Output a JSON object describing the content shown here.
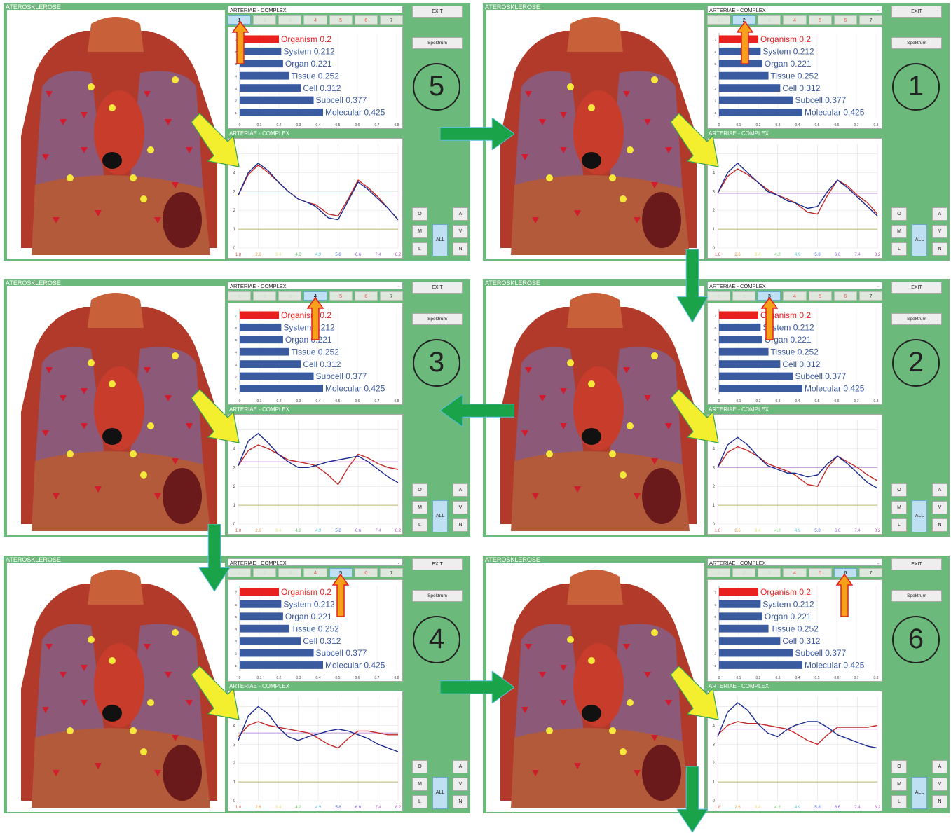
{
  "window_title": "ATEROSKLEROSE",
  "section": "ARTERIAE - COMPLEX",
  "chart_title": "ARTERIAE - COMPLEX",
  "buttons": {
    "exit": "EXIT",
    "spektrum": "Spektrum",
    "o": "O",
    "a": "A",
    "m": "M",
    "v": "V",
    "l": "L",
    "n": "N",
    "all": "ALL"
  },
  "tabs": [
    "1",
    "2",
    "3",
    "4",
    "5",
    "6",
    "7"
  ],
  "colors": {
    "panel": "#6cb97c",
    "bar_blue": "#3a5ba0",
    "bar_red": "#e82020",
    "line_blue": "#1a2a8c",
    "line_red": "#c02828",
    "flow_arrow": "#1aa348",
    "hint_arrow": "#f4ef2e"
  },
  "panels": [
    {
      "step": "5",
      "active_tab": 1
    },
    {
      "step": "1",
      "active_tab": 2
    },
    {
      "step": "3",
      "active_tab": 4
    },
    {
      "step": "2",
      "active_tab": 3
    },
    {
      "step": "4",
      "active_tab": 5
    },
    {
      "step": "6",
      "active_tab": 6
    }
  ],
  "chart_data": [
    {
      "type": "bar",
      "orientation": "horizontal",
      "categories": [
        "Organism 0.2",
        "System 0.212",
        "Organ 0.221",
        "Tissue  0.252",
        "Cell 0.312",
        "Subcell 0.377",
        "Molecular 0.425"
      ],
      "values": [
        0.2,
        0.212,
        0.221,
        0.252,
        0.312,
        0.377,
        0.425
      ],
      "xlim": [
        0,
        0.8
      ],
      "xticks": [
        "0",
        "0.1",
        "0.2",
        "0.3",
        "0.4",
        "0.5",
        "0.6",
        "0.7",
        "0.8"
      ],
      "ylabels": [
        "7",
        "6",
        "5",
        "4",
        "3",
        "2",
        "1"
      ]
    },
    {
      "type": "line",
      "x_ticks": [
        "1.8",
        "2.6",
        "3.4",
        "4.2",
        "4.9",
        "5.8",
        "6.6",
        "7.4",
        "8.2"
      ],
      "x_tick_colors": [
        "#e85a5a",
        "#e8923a",
        "#e6e070",
        "#5cc85c",
        "#5cc8e0",
        "#4a6ae0",
        "#8a5ae0",
        "#b070e0",
        "#b050b0"
      ],
      "yticks": [
        "0",
        "1",
        "2",
        "3",
        "4",
        "5"
      ],
      "ylim": [
        0,
        5.5
      ],
      "x": [
        1.8,
        2.2,
        2.6,
        3.0,
        3.4,
        3.8,
        4.2,
        4.6,
        4.9,
        5.4,
        5.8,
        6.2,
        6.6,
        7.0,
        7.4,
        7.8,
        8.2
      ],
      "panels": [
        {
          "blue": [
            2.8,
            4.0,
            4.5,
            4.1,
            3.5,
            3.0,
            2.6,
            2.4,
            2.2,
            1.6,
            1.5,
            2.5,
            3.5,
            3.1,
            2.6,
            2.1,
            1.5
          ],
          "red": [
            2.8,
            3.9,
            4.4,
            4.0,
            3.5,
            3.0,
            2.6,
            2.4,
            2.3,
            1.8,
            1.7,
            2.6,
            3.6,
            3.2,
            2.7,
            2.1,
            1.5
          ],
          "ref_purple": 2.8,
          "ref_yellow": 1.0
        },
        {
          "blue": [
            2.9,
            4.0,
            4.5,
            4.0,
            3.5,
            3.0,
            2.8,
            2.5,
            2.4,
            2.1,
            2.2,
            3.0,
            3.6,
            3.2,
            2.7,
            2.2,
            1.7
          ],
          "red": [
            2.9,
            3.8,
            4.2,
            3.9,
            3.5,
            3.1,
            2.8,
            2.6,
            2.4,
            1.9,
            1.8,
            2.8,
            3.6,
            3.3,
            2.8,
            2.4,
            1.8
          ],
          "ref_purple": 2.9,
          "ref_yellow": 1.0
        },
        {
          "blue": [
            3.1,
            4.4,
            4.8,
            4.3,
            3.7,
            3.3,
            3.0,
            3.0,
            3.1,
            3.3,
            3.4,
            3.5,
            3.6,
            3.3,
            2.9,
            2.5,
            2.2
          ],
          "red": [
            3.1,
            3.9,
            4.2,
            4.0,
            3.7,
            3.4,
            3.3,
            3.2,
            3.1,
            2.6,
            2.1,
            3.0,
            3.7,
            3.5,
            3.2,
            3.0,
            2.9
          ],
          "ref_purple": 3.3,
          "ref_yellow": 1.0
        },
        {
          "blue": [
            3.0,
            4.2,
            4.6,
            4.2,
            3.6,
            3.1,
            2.9,
            2.7,
            2.7,
            2.5,
            2.6,
            3.2,
            3.6,
            3.2,
            2.7,
            2.2,
            1.9
          ],
          "red": [
            3.0,
            3.8,
            4.1,
            3.9,
            3.6,
            3.2,
            3.0,
            2.8,
            2.6,
            2.1,
            2.0,
            3.0,
            3.6,
            3.3,
            3.0,
            2.6,
            2.3
          ],
          "ref_purple": 3.0,
          "ref_yellow": 1.0
        },
        {
          "blue": [
            3.2,
            4.5,
            5.0,
            4.6,
            3.9,
            3.4,
            3.2,
            3.4,
            3.5,
            3.7,
            3.8,
            3.7,
            3.5,
            3.3,
            3.0,
            2.8,
            2.6
          ],
          "red": [
            3.4,
            4.0,
            4.2,
            4.0,
            3.9,
            3.8,
            3.7,
            3.6,
            3.4,
            3.0,
            2.8,
            3.3,
            3.7,
            3.7,
            3.6,
            3.5,
            3.5
          ],
          "ref_purple": 3.6,
          "ref_yellow": 1.0
        },
        {
          "blue": [
            3.4,
            4.7,
            5.2,
            4.8,
            4.1,
            3.6,
            3.4,
            3.8,
            4.0,
            4.2,
            4.2,
            3.9,
            3.5,
            3.3,
            3.1,
            2.9,
            2.8
          ],
          "red": [
            3.5,
            4.0,
            4.2,
            4.1,
            4.1,
            4.0,
            3.9,
            3.8,
            3.6,
            3.2,
            3.0,
            3.5,
            3.9,
            3.9,
            3.9,
            3.9,
            4.0
          ],
          "ref_purple": 3.8,
          "ref_yellow": 1.0
        }
      ]
    }
  ]
}
